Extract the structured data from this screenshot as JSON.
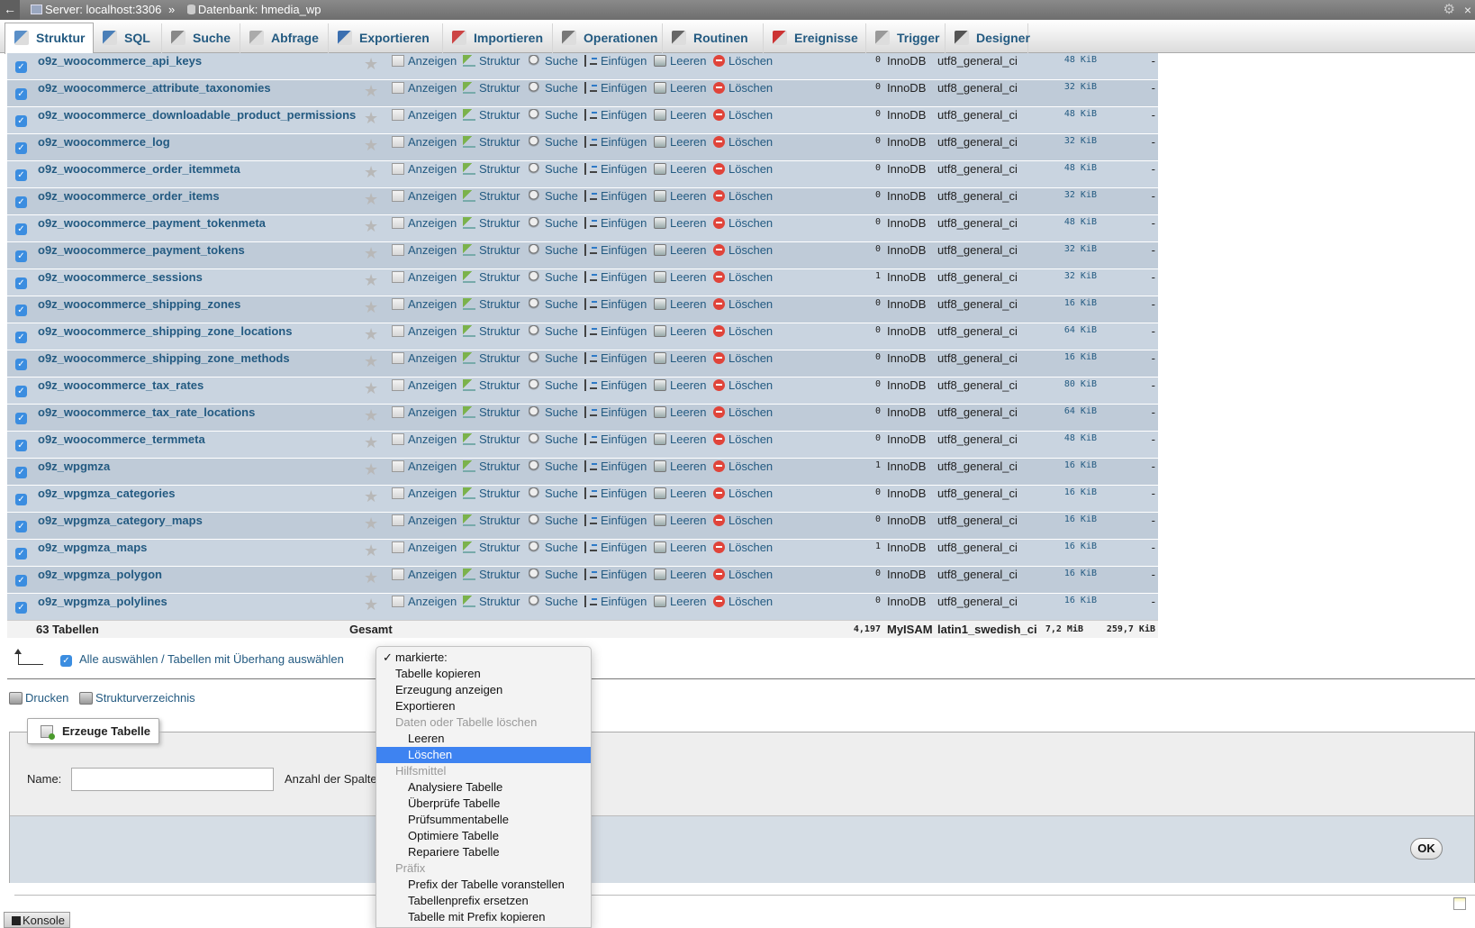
{
  "topbar": {
    "server": "Server: localhost:3306",
    "separator": "»",
    "database": "Datenbank: hmedia_wp"
  },
  "tabs": [
    {
      "label": "Struktur",
      "icon": "structure-icon",
      "active": true
    },
    {
      "label": "SQL",
      "icon": "sql-icon"
    },
    {
      "label": "Suche",
      "icon": "search-icon"
    },
    {
      "label": "Abfrage",
      "icon": "query-icon"
    },
    {
      "label": "Exportieren",
      "icon": "export-icon"
    },
    {
      "label": "Importieren",
      "icon": "import-icon"
    },
    {
      "label": "Operationen",
      "icon": "wrench-icon"
    },
    {
      "label": "Routinen",
      "icon": "routines-icon"
    },
    {
      "label": "Ereignisse",
      "icon": "clock-icon"
    },
    {
      "label": "Trigger",
      "icon": "trigger-icon"
    },
    {
      "label": "Designer",
      "icon": "designer-icon"
    }
  ],
  "actions": {
    "view": "Anzeigen",
    "structure": "Struktur",
    "search": "Suche",
    "insert": "Einfügen",
    "empty": "Leeren",
    "drop": "Löschen"
  },
  "rows": [
    {
      "name": "o9z_woocommerce_api_keys",
      "rows": "0",
      "engine": "InnoDB",
      "collation": "utf8_general_ci",
      "size": "48 KiB",
      "overhead": "-"
    },
    {
      "name": "o9z_woocommerce_attribute_taxonomies",
      "rows": "0",
      "engine": "InnoDB",
      "collation": "utf8_general_ci",
      "size": "32 KiB",
      "overhead": "-"
    },
    {
      "name": "o9z_woocommerce_downloadable_product_permissions",
      "rows": "0",
      "engine": "InnoDB",
      "collation": "utf8_general_ci",
      "size": "48 KiB",
      "overhead": "-"
    },
    {
      "name": "o9z_woocommerce_log",
      "rows": "0",
      "engine": "InnoDB",
      "collation": "utf8_general_ci",
      "size": "32 KiB",
      "overhead": "-"
    },
    {
      "name": "o9z_woocommerce_order_itemmeta",
      "rows": "0",
      "engine": "InnoDB",
      "collation": "utf8_general_ci",
      "size": "48 KiB",
      "overhead": "-"
    },
    {
      "name": "o9z_woocommerce_order_items",
      "rows": "0",
      "engine": "InnoDB",
      "collation": "utf8_general_ci",
      "size": "32 KiB",
      "overhead": "-"
    },
    {
      "name": "o9z_woocommerce_payment_tokenmeta",
      "rows": "0",
      "engine": "InnoDB",
      "collation": "utf8_general_ci",
      "size": "48 KiB",
      "overhead": "-"
    },
    {
      "name": "o9z_woocommerce_payment_tokens",
      "rows": "0",
      "engine": "InnoDB",
      "collation": "utf8_general_ci",
      "size": "32 KiB",
      "overhead": "-"
    },
    {
      "name": "o9z_woocommerce_sessions",
      "rows": "1",
      "engine": "InnoDB",
      "collation": "utf8_general_ci",
      "size": "32 KiB",
      "overhead": "-"
    },
    {
      "name": "o9z_woocommerce_shipping_zones",
      "rows": "0",
      "engine": "InnoDB",
      "collation": "utf8_general_ci",
      "size": "16 KiB",
      "overhead": "-"
    },
    {
      "name": "o9z_woocommerce_shipping_zone_locations",
      "rows": "0",
      "engine": "InnoDB",
      "collation": "utf8_general_ci",
      "size": "64 KiB",
      "overhead": "-"
    },
    {
      "name": "o9z_woocommerce_shipping_zone_methods",
      "rows": "0",
      "engine": "InnoDB",
      "collation": "utf8_general_ci",
      "size": "16 KiB",
      "overhead": "-"
    },
    {
      "name": "o9z_woocommerce_tax_rates",
      "rows": "0",
      "engine": "InnoDB",
      "collation": "utf8_general_ci",
      "size": "80 KiB",
      "overhead": "-"
    },
    {
      "name": "o9z_woocommerce_tax_rate_locations",
      "rows": "0",
      "engine": "InnoDB",
      "collation": "utf8_general_ci",
      "size": "64 KiB",
      "overhead": "-"
    },
    {
      "name": "o9z_woocommerce_termmeta",
      "rows": "0",
      "engine": "InnoDB",
      "collation": "utf8_general_ci",
      "size": "48 KiB",
      "overhead": "-"
    },
    {
      "name": "o9z_wpgmza",
      "rows": "1",
      "engine": "InnoDB",
      "collation": "utf8_general_ci",
      "size": "16 KiB",
      "overhead": "-"
    },
    {
      "name": "o9z_wpgmza_categories",
      "rows": "0",
      "engine": "InnoDB",
      "collation": "utf8_general_ci",
      "size": "16 KiB",
      "overhead": "-"
    },
    {
      "name": "o9z_wpgmza_category_maps",
      "rows": "0",
      "engine": "InnoDB",
      "collation": "utf8_general_ci",
      "size": "16 KiB",
      "overhead": "-"
    },
    {
      "name": "o9z_wpgmza_maps",
      "rows": "1",
      "engine": "InnoDB",
      "collation": "utf8_general_ci",
      "size": "16 KiB",
      "overhead": "-"
    },
    {
      "name": "o9z_wpgmza_polygon",
      "rows": "0",
      "engine": "InnoDB",
      "collation": "utf8_general_ci",
      "size": "16 KiB",
      "overhead": "-"
    },
    {
      "name": "o9z_wpgmza_polylines",
      "rows": "0",
      "engine": "InnoDB",
      "collation": "utf8_general_ci",
      "size": "16 KiB",
      "overhead": "-"
    }
  ],
  "total": {
    "count": "63 Tabellen",
    "label": "Gesamt",
    "rows": "4,197",
    "engine": "MyISAM",
    "collation": "latin1_swedish_ci",
    "overhead_size": "7,2 MiB",
    "size": "259,7 KiB"
  },
  "select_all": {
    "label": "Alle auswählen / Tabellen mit Überhang auswählen"
  },
  "links": {
    "print": "Drucken",
    "data_dictionary": "Strukturverzeichnis"
  },
  "create_table": {
    "legend": "Erzeuge Tabelle",
    "name_label": "Name:",
    "name_value": "",
    "columns_label": "Anzahl der Spalte",
    "ok": "OK"
  },
  "dropdown": {
    "items": [
      {
        "label": "markierte:",
        "level": 0,
        "checked": true
      },
      {
        "label": "Tabelle kopieren",
        "level": 0
      },
      {
        "label": "Erzeugung anzeigen",
        "level": 0
      },
      {
        "label": "Exportieren",
        "level": 0
      },
      {
        "label": "Daten oder Tabelle löschen",
        "level": 0,
        "group": true
      },
      {
        "label": "Leeren",
        "level": 1
      },
      {
        "label": "Löschen",
        "level": 1,
        "selected": true
      },
      {
        "label": "Hilfsmittel",
        "level": 0,
        "group": true
      },
      {
        "label": "Analysiere Tabelle",
        "level": 1
      },
      {
        "label": "Überprüfe Tabelle",
        "level": 1
      },
      {
        "label": "Prüfsummentabelle",
        "level": 1
      },
      {
        "label": "Optimiere Tabelle",
        "level": 1
      },
      {
        "label": "Repariere Tabelle",
        "level": 1
      },
      {
        "label": "Präfix",
        "level": 0,
        "group": true
      },
      {
        "label": "Prefix der Tabelle voranstellen",
        "level": 1
      },
      {
        "label": "Tabellenprefix ersetzen",
        "level": 1
      },
      {
        "label": "Tabelle mit Prefix kopieren",
        "level": 1
      }
    ],
    "checkmark": "✓"
  },
  "console": {
    "label": "Konsole"
  },
  "colors": {
    "link": "#235a81",
    "row_odd": "#c9d4e0",
    "row_even": "#bfcbd8",
    "selected": "#3e83f1",
    "drop_icon": "#e0443a"
  }
}
